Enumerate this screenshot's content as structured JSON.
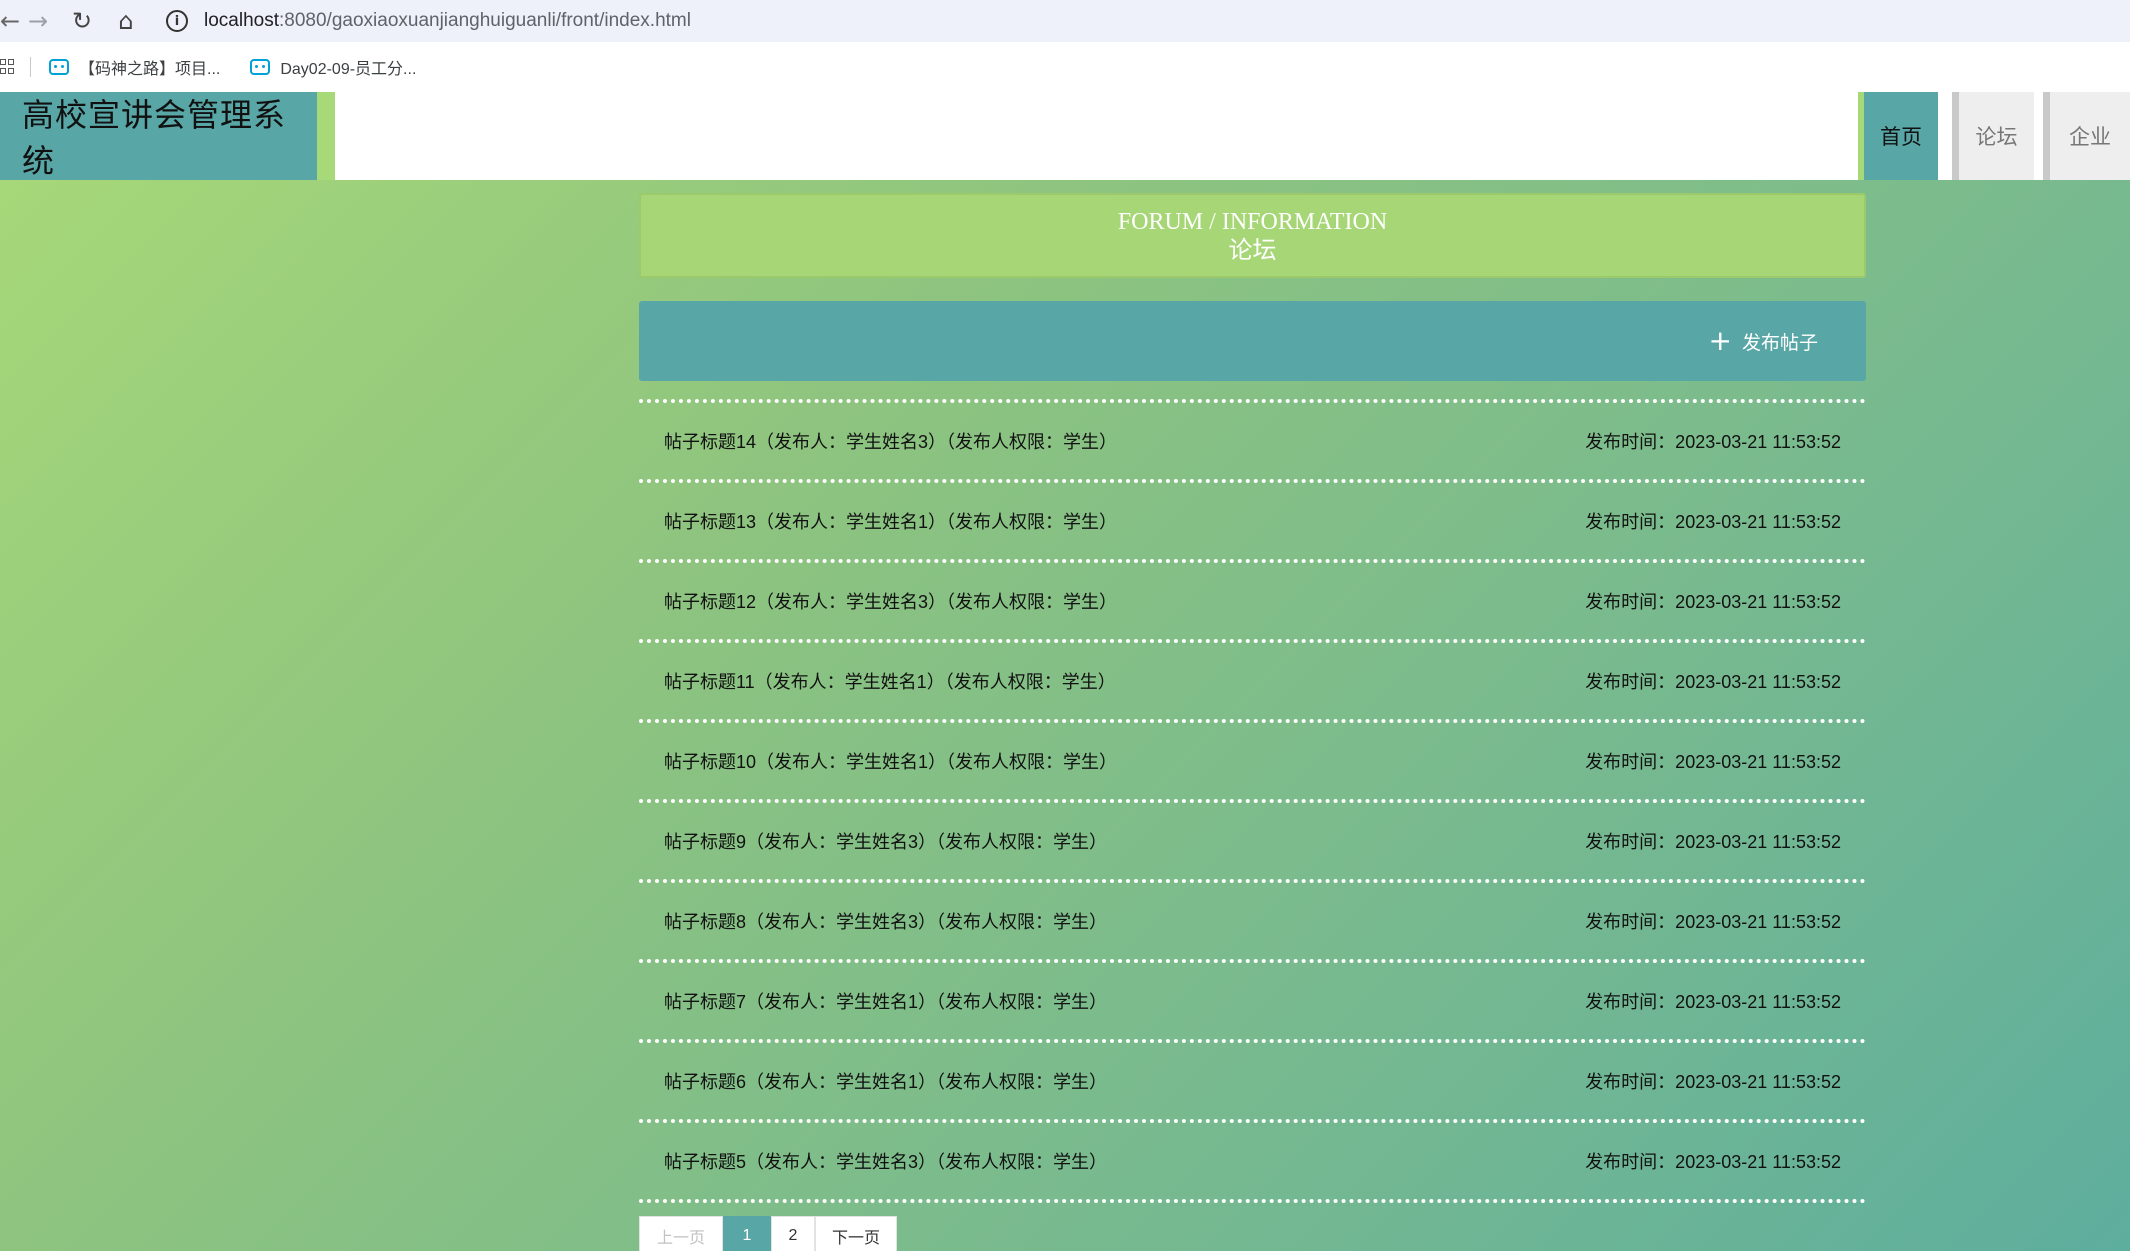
{
  "browser": {
    "back_icon": "←",
    "forward_icon": "→",
    "reload_icon": "↻",
    "home_icon": "⌂",
    "info_icon": "i",
    "url_host": "localhost",
    "url_path": ":8080/gaoxiaoxuanjianghuiguanli/front/index.html",
    "bookmarks": [
      {
        "label": "【码神之路】项目..."
      },
      {
        "label": "Day02-09-员工分..."
      }
    ]
  },
  "site": {
    "title": "高校宣讲会管理系统",
    "nav": {
      "home": "首页",
      "forum": "论坛",
      "company": "企业"
    }
  },
  "section": {
    "title_en": "FORUM / INFORMATION",
    "title_cn": "论坛",
    "post_button": "发布帖子",
    "post_icon": "+"
  },
  "posts": [
    {
      "title": "帖子标题14（发布人：学生姓名3）（发布人权限：学生）",
      "time": "发布时间：2023-03-21 11:53:52"
    },
    {
      "title": "帖子标题13（发布人：学生姓名1）（发布人权限：学生）",
      "time": "发布时间：2023-03-21 11:53:52"
    },
    {
      "title": "帖子标题12（发布人：学生姓名3）（发布人权限：学生）",
      "time": "发布时间：2023-03-21 11:53:52"
    },
    {
      "title": "帖子标题11（发布人：学生姓名1）（发布人权限：学生）",
      "time": "发布时间：2023-03-21 11:53:52"
    },
    {
      "title": "帖子标题10（发布人：学生姓名1）（发布人权限：学生）",
      "time": "发布时间：2023-03-21 11:53:52"
    },
    {
      "title": "帖子标题9（发布人：学生姓名3）（发布人权限：学生）",
      "time": "发布时间：2023-03-21 11:53:52"
    },
    {
      "title": "帖子标题8（发布人：学生姓名3）（发布人权限：学生）",
      "time": "发布时间：2023-03-21 11:53:52"
    },
    {
      "title": "帖子标题7（发布人：学生姓名1）（发布人权限：学生）",
      "time": "发布时间：2023-03-21 11:53:52"
    },
    {
      "title": "帖子标题6（发布人：学生姓名1）（发布人权限：学生）",
      "time": "发布时间：2023-03-21 11:53:52"
    },
    {
      "title": "帖子标题5（发布人：学生姓名3）（发布人权限：学生）",
      "time": "发布时间：2023-03-21 11:53:52"
    }
  ],
  "pagination": {
    "prev": "上一页",
    "page1": "1",
    "page2": "2",
    "next": "下一页",
    "current_page": 1
  },
  "colors": {
    "teal": "#58a6a6",
    "green": "#a8d978"
  }
}
